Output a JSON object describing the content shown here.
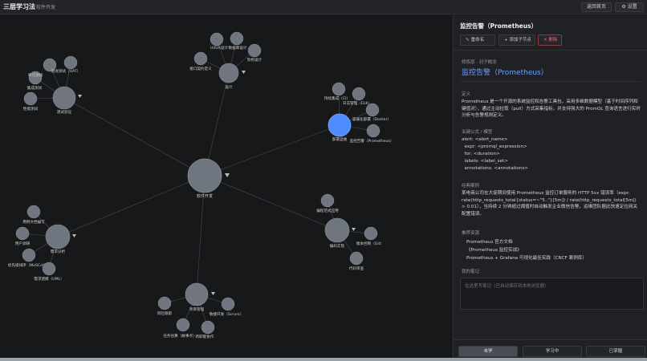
{
  "app": {
    "title": "三层学习法",
    "breadcrumb": "软件开发"
  },
  "topbar": {
    "home_label": "返回首页",
    "settings_label": "⚙ 设置"
  },
  "graph": {
    "center": "软件开发",
    "hubs": {
      "test": "测试验证",
      "design": "设计",
      "deploy": "部署运维",
      "req": "需求分析",
      "impl": "编码实现",
      "pm": "项目管理"
    },
    "leaves": {
      "unit_test": "单元测试",
      "uat": "验收测试（UAT）",
      "integration_test": "集成测试",
      "perf_test": "性能测试",
      "uiux": "UI/UX设计",
      "db_design": "数据库设计",
      "api_design": "接口契约定义",
      "arch_design": "架构设计",
      "ci": "持续集成（CI）",
      "logging": "日志管理（ELK）",
      "docker": "容器化部署（Docker）",
      "prometheus": "监控告警（Prometheus）",
      "usecase": "用例文档编写",
      "user_research": "用户调研",
      "moscow": "优先级排序（MoSCoW）",
      "uml": "需求建模（UML）",
      "code_style": "编程范式应用",
      "git": "版本控制（Git）",
      "code_review": "代码审查",
      "risk": "风险跟踪",
      "scrum": "敏捷开发（Scrum）",
      "estimation": "任务估算（故事点）",
      "collab": "跨职能协作"
    }
  },
  "panel": {
    "title": "监控告警（Prometheus）",
    "buttons": {
      "rename": "重命名",
      "add_child": "+ 添加子节点",
      "delete": "删除"
    },
    "kicker": "修炼层 · 对子概念",
    "big_title": "监控告警（Prometheus）",
    "definition_label": "定义",
    "definition": "Prometheus 是一个开源的系统监控和告警工具包，采用多维数据模型（基于时间序列和键值对），通过主动拉取（pull）方式采集指标，并支持强大的 PromQL 查询语言进行实时分析与告警规则定义。",
    "formula_label": "关键公式 / 模型",
    "formula_lines": [
      "alert: <alert_name>",
      "  expr: <promql_expression>",
      "  for: <duration>",
      "  labels: <label_set>",
      "  annotations: <annotations>"
    ],
    "case_label": "经典案例",
    "case_text": "某电商公司在大促期间使用 Prometheus 监控订单服务的 HTTP 5xx 错误率（expr: rate(http_requests_total{status=~\"5..\"}[5m]) / rate(http_requests_total[5m]) > 0.01），当持续 2 分钟超过阈值时自动触发企业微信告警，运维团队据此快速定位网关配置错误。",
    "resources_label": "推荐资源",
    "resources": [
      "Prometheus 官方文档",
      "《Prometheus 监控实战》",
      "Prometheus + Grafana 可视化最佳实践（CNCF 案例库）"
    ],
    "notes_label": "我的笔记",
    "notes_placeholder": "在这里写笔记（已自动保存到本地浏览器）",
    "status": {
      "unlearned": "未学",
      "learning": "学习中",
      "mastered": "已掌握"
    }
  },
  "colors": {
    "selected_node": "#4f8cff",
    "node": "#6f7680",
    "accent_text": "#6aa0ff",
    "delete": "#e07070"
  }
}
